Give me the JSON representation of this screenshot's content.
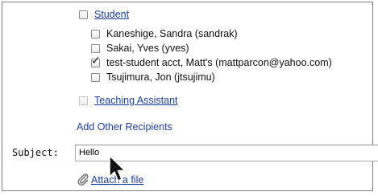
{
  "recipients": {
    "student_group": {
      "label": "Student",
      "checked": false,
      "members": [
        {
          "label": "Kaneshige, Sandra (sandrak)",
          "checked": false
        },
        {
          "label": "Sakai, Yves (yves)",
          "checked": false
        },
        {
          "label": "test-student acct, Matt's (mattparcon@yahoo.com)",
          "checked": true
        },
        {
          "label": "Tsujimura, Jon (jtsujimu)",
          "checked": false
        }
      ]
    },
    "ta_group": {
      "label": "Teaching Assistant",
      "checked": false
    },
    "add_other_label": "Add Other Recipients"
  },
  "subject": {
    "label": "Subject:",
    "value": "Hello"
  },
  "attach": {
    "label": "Attach a file"
  },
  "icons": {
    "checkmark": "check-icon",
    "paperclip": "paperclip-icon",
    "cursor": "mouse-pointer-icon"
  },
  "colors": {
    "link": "#1f3f99",
    "border": "#7d7d7d"
  }
}
